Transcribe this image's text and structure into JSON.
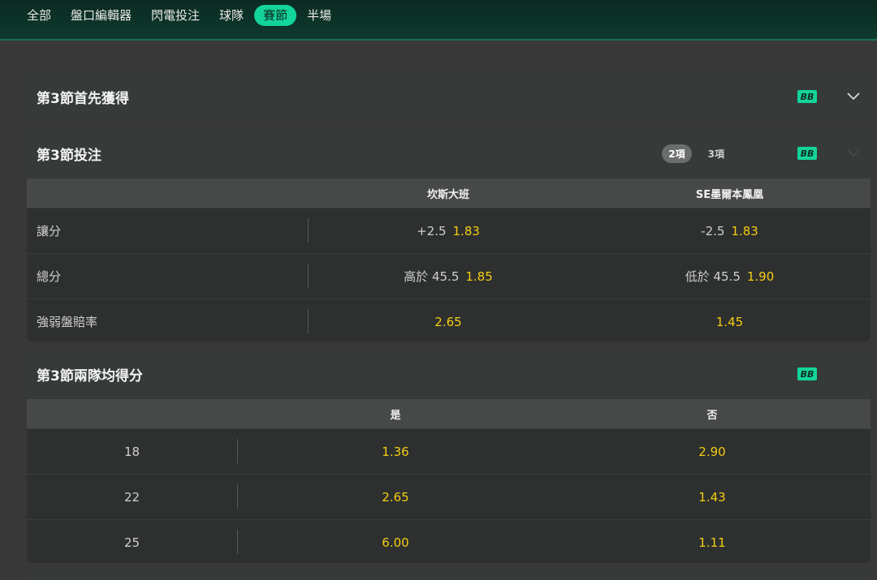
{
  "nav": {
    "tabs": [
      {
        "label": "全部"
      },
      {
        "label": "盤口編輯器"
      },
      {
        "label": "閃電投注"
      },
      {
        "label": "球隊"
      },
      {
        "label": "賽節",
        "active": true
      },
      {
        "label": "半場"
      }
    ]
  },
  "colors": {
    "accent": "#13d49a",
    "odds": "#f4cc12",
    "bg": "#383838",
    "panel": "#2d302f"
  },
  "markets": {
    "first_to_score": {
      "title": "第3節首先獲得",
      "badge": "BB",
      "expand_icon": "chevron-down-icon"
    },
    "quarter_bet": {
      "title": "第3節投注",
      "toggle": [
        "2項",
        "3項"
      ],
      "badge": "BB",
      "teams": [
        "坎斯大班",
        "SE墨爾本鳳凰"
      ],
      "rows": [
        {
          "label": "讓分",
          "home": {
            "line": "+2.5",
            "odds": "1.83"
          },
          "away": {
            "line": "-2.5",
            "odds": "1.83"
          }
        },
        {
          "label": "總分",
          "home": {
            "line": "高於 45.5",
            "odds": "1.85"
          },
          "away": {
            "line": "低於 45.5",
            "odds": "1.90"
          }
        },
        {
          "label": "強弱盤賠率",
          "home": {
            "line": "",
            "odds": "2.65"
          },
          "away": {
            "line": "",
            "odds": "1.45"
          }
        }
      ]
    },
    "both_teams_score": {
      "title": "第3節兩隊均得分",
      "badge": "BB",
      "columns": [
        "是",
        "否"
      ],
      "rows": [
        {
          "label": "18",
          "yes": "1.36",
          "no": "2.90"
        },
        {
          "label": "22",
          "yes": "2.65",
          "no": "1.43"
        },
        {
          "label": "25",
          "yes": "6.00",
          "no": "1.11"
        }
      ]
    }
  }
}
